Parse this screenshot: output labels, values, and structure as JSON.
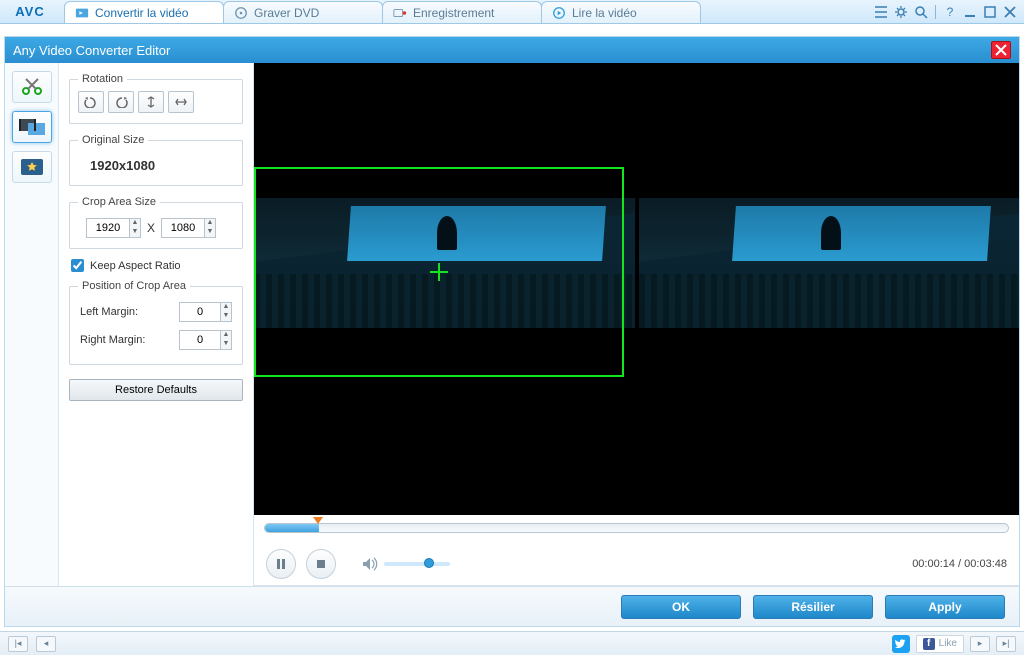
{
  "app": {
    "logo": "AVC"
  },
  "tabs": {
    "convert": "Convertir la vidéo",
    "burn": "Graver DVD",
    "record": "Enregistrement",
    "play": "Lire la vidéo"
  },
  "editor": {
    "title": "Any Video Converter Editor",
    "rotation_legend": "Rotation",
    "original_legend": "Original Size",
    "original_value": "1920x1080",
    "crop_legend": "Crop Area Size",
    "crop_w": "1920",
    "crop_sep": "X",
    "crop_h": "1080",
    "keep_ratio": "Keep Aspect Ratio",
    "position_legend": "Position of Crop Area",
    "left_margin_label": "Left Margin:",
    "left_margin_value": "0",
    "right_margin_label": "Right Margin:",
    "right_margin_value": "0",
    "restore": "Restore Defaults",
    "time": "00:00:14 / 00:03:48",
    "ok": "OK",
    "cancel": "Résilier",
    "apply": "Apply"
  },
  "status": {
    "like": "Like"
  }
}
